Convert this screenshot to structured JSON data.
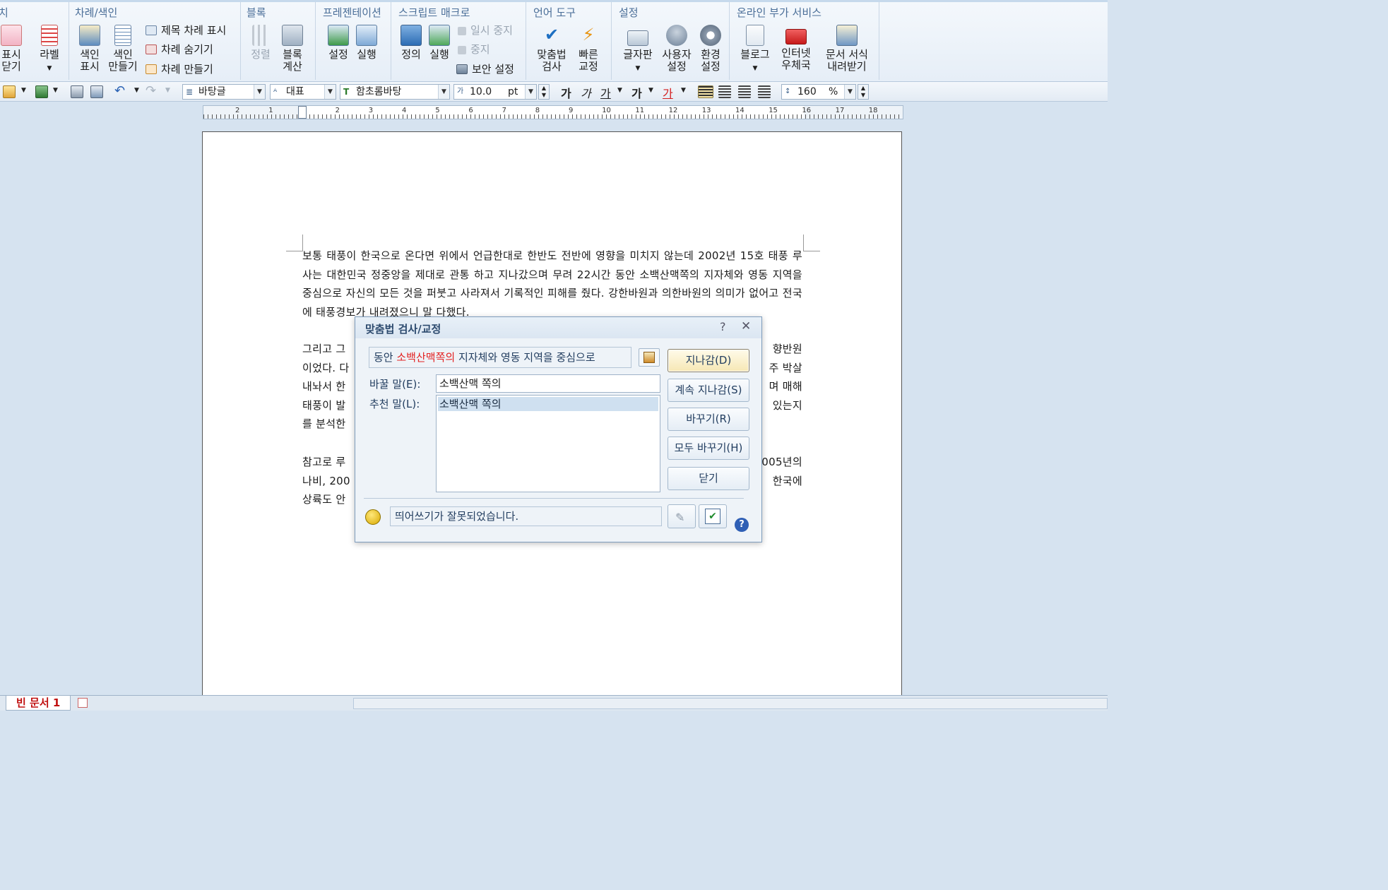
{
  "ribbon": {
    "groups": [
      {
        "title": "치"
      },
      {
        "title": "차례/색인"
      },
      {
        "title": "블록"
      },
      {
        "title": "프레젠테이션"
      },
      {
        "title": "스크립트 매크로"
      },
      {
        "title": "언어 도구"
      },
      {
        "title": "설정"
      },
      {
        "title": "온라인 부가 서비스"
      }
    ],
    "show_hide": {
      "line1": "표시",
      "line2": "닫기"
    },
    "label": {
      "line1": "라벨"
    },
    "index_show": {
      "line1": "색인",
      "line2": "표시"
    },
    "index_make": {
      "line1": "색인",
      "line2": "만들기"
    },
    "toc_title_show": "제목 차례 표시",
    "toc_hide": "차례 숨기기",
    "toc_make": "차례 만들기",
    "block_sort": {
      "line1": "정렬"
    },
    "block_calc": {
      "line1": "블록",
      "line2": "계산"
    },
    "pres_setup": {
      "line1": "설정"
    },
    "pres_run": {
      "line1": "실행"
    },
    "macro_define": {
      "line1": "정의"
    },
    "macro_run": {
      "line1": "실행"
    },
    "macro_pause": "일시 중지",
    "macro_stop": "중지",
    "macro_security": "보안 설정",
    "spell_check": {
      "line1": "맞춤법",
      "line2": "검사"
    },
    "quick_correct": {
      "line1": "빠른",
      "line2": "교정"
    },
    "keyboard": {
      "line1": "글자판"
    },
    "user_settings": {
      "line1": "사용자",
      "line2": "설정"
    },
    "env_settings": {
      "line1": "환경",
      "line2": "설정"
    },
    "blog": {
      "line1": "블로그"
    },
    "internet_post": {
      "line1": "인터넷",
      "line2": "우체국"
    },
    "doc_templates": {
      "line1": "문서 서식",
      "line2": "내려받기"
    }
  },
  "toolbar": {
    "style": "바탕글",
    "language": "대표",
    "font": "함초롬바탕",
    "font_size": "10.0",
    "font_unit": "pt",
    "line_spacing": "160",
    "line_spacing_unit": "%",
    "bold": "가",
    "italic": "가",
    "underline": "가",
    "strike": "가",
    "color": "가"
  },
  "ruler": {
    "labels": [
      "2",
      "1",
      "1",
      "2",
      "3",
      "4",
      "5",
      "6",
      "7",
      "8",
      "9",
      "10",
      "11",
      "12",
      "13",
      "14",
      "15",
      "16",
      "17",
      "18"
    ]
  },
  "document": {
    "paragraphs": [
      "보통 태풍이 한국으로 온다면 위에서 언급한대로 한반도 전반에 영향을 미치지 않는데 2002년 15호 태풍 루사는 대한민국 정중앙을 제대로 관통 하고 지나갔으며 무려 22시간 동안 소백산맥쪽의 지자체와 영동 지역을 중심으로 자신의 모든 것을 퍼붓고 사라져서 기록적인 피해를 줬다. 강한바원과 의한바원의 의미가 없어고 전국에 태풍경보가 내려졌으니 말 다했다.",
      "그리고 그                                                                              향반원이었다. 다                                                                                주 박살내놔서 한                                                                                며 매해태풍이 발                                                                              있는지를 분석한",
      "참고로 루                                                                              005년의나비, 200                                                                              한국에상륙도 안"
    ],
    "p1": "보통 태풍이 한국으로 온다면 위에서 언급한대로 한반도 전반에 영향을 미치지 않는데 2002년 15호 태풍 루사는 대한민국 정중앙을 제대로 관통 하고 지나갔으며 무려 22시간 동안 소백산맥쪽의 지자체와 영동 지역을 중심으로 자신의 모든 것을 퍼붓고 사라져서 기록적인 피해를 줬다. 강한바원과 의한바원의 의미가 없어고 전국에 태풍경보가 내려졌으니 말 다했다.",
    "p2_lines": [
      [
        "그리고 그",
        "향반원"
      ],
      [
        "이었다. 다",
        "주 박살"
      ],
      [
        "내놔서 한",
        "며 매해"
      ],
      [
        "태풍이 발",
        "있는지"
      ],
      [
        "를 분석한",
        ""
      ]
    ],
    "p3_lines": [
      [
        "참고로 루",
        "005년의"
      ],
      [
        "나비, 200",
        "한국에"
      ],
      [
        "상륙도 안",
        ""
      ]
    ]
  },
  "dialog": {
    "title": "맞춤법 검사/교정",
    "help_glyph": "?",
    "close_glyph": "✕",
    "context_before": "동안 ",
    "context_error": "소백산맥쪽의",
    "context_after": " 지자체와 영동 지역을 중심으로",
    "replace_label": "바꿀 말(E):",
    "suggest_label": "추천 말(L):",
    "replace_value": "소백산맥 쪽의",
    "suggestions": [
      "소백산맥 쪽의"
    ],
    "btn_skip": "지나감(D)",
    "btn_skip_all": "계속 지나감(S)",
    "btn_replace": "바꾸기(R)",
    "btn_replace_all": "모두 바꾸기(H)",
    "btn_close": "닫기",
    "status": "띄어쓰기가 잘못되었습니다.",
    "help_badge": "?"
  },
  "tabs": {
    "doc_tab": "빈 문서 1"
  }
}
